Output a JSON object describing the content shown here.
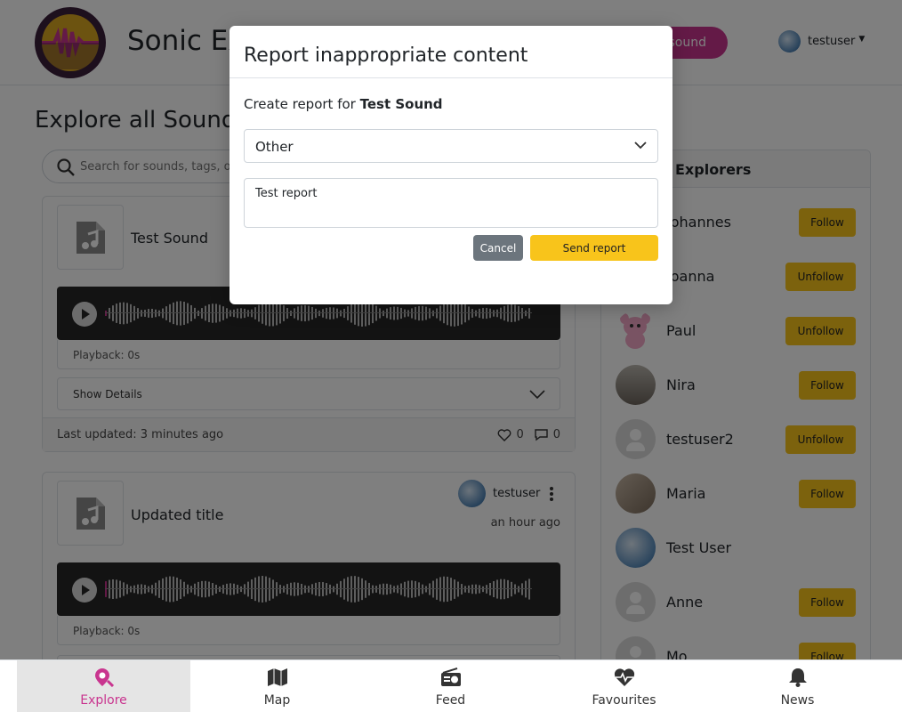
{
  "header": {
    "app_title": "Sonic Explorers",
    "add_sound_label": "Add sound",
    "username": "testuser"
  },
  "main": {
    "heading": "Explore all Sounds",
    "search_placeholder": "Search for sounds, tags, or users",
    "cards": [
      {
        "title": "Test Sound",
        "playback": "Playback: 0s",
        "show_details": "Show Details",
        "last_updated": "Last updated: 3 minutes ago",
        "likes": "0",
        "comments": "0"
      },
      {
        "title": "Updated title",
        "owner": "testuser",
        "time_ago": "an hour ago",
        "playback": "Playback: 0s"
      }
    ]
  },
  "explorers": {
    "heading": "Explorers",
    "items": [
      {
        "name": "Johannes",
        "button": "Follow"
      },
      {
        "name": "Joanna",
        "button": "Unfollow"
      },
      {
        "name": "Paul",
        "button": "Unfollow"
      },
      {
        "name": "Nira",
        "button": "Follow"
      },
      {
        "name": "testuser2",
        "button": "Unfollow"
      },
      {
        "name": "Maria",
        "button": "Follow"
      },
      {
        "name": "Test User",
        "button": ""
      },
      {
        "name": "Anne",
        "button": "Follow"
      },
      {
        "name": "Mo",
        "button": "Follow"
      }
    ]
  },
  "modal": {
    "title": "Report inappropriate content",
    "subtitle_prefix": "Create report for",
    "sound_name": "Test Sound",
    "reason_selected": "Other",
    "report_text": "Test report",
    "cancel_label": "Cancel",
    "send_label": "Send report"
  },
  "bottom_nav": {
    "items": [
      {
        "label": "Explore",
        "icon": "map-pin-search-icon"
      },
      {
        "label": "Map",
        "icon": "map-icon"
      },
      {
        "label": "Feed",
        "icon": "radio-icon"
      },
      {
        "label": "Favourites",
        "icon": "heart-pulse-icon"
      },
      {
        "label": "News",
        "icon": "bell-icon"
      }
    ],
    "active_index": 0
  },
  "colors": {
    "accent": "#c9358f",
    "button_yellow": "#f8c41b",
    "cancel_gray": "#6c757d"
  }
}
